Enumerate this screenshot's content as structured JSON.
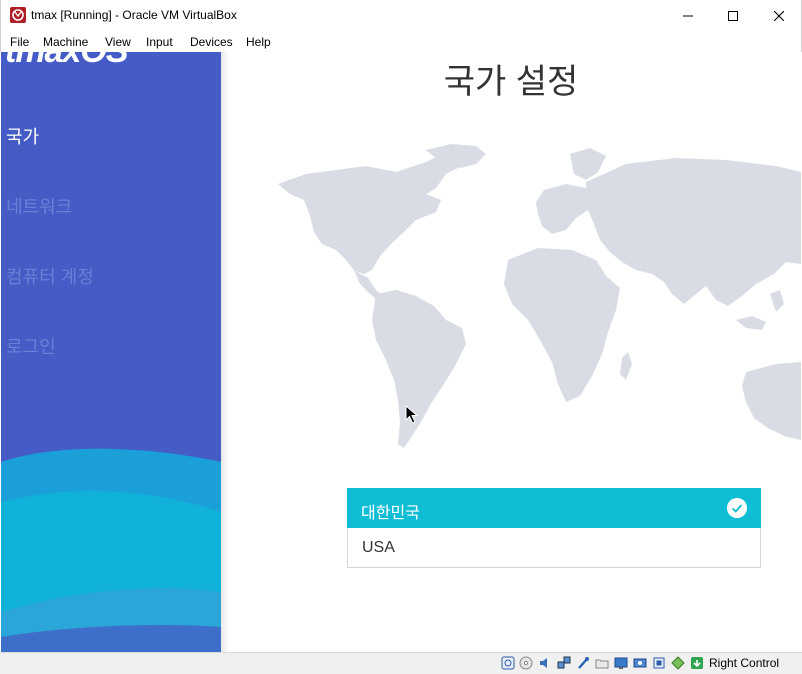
{
  "window": {
    "title": "tmax [Running] - Oracle VM VirtualBox",
    "app_icon": "virtualbox-icon",
    "controls": [
      "minimize-icon",
      "maximize-icon",
      "close-icon"
    ]
  },
  "menubar": {
    "items": [
      "File",
      "Machine",
      "View",
      "Input",
      "Devices",
      "Help"
    ]
  },
  "installer": {
    "logo_text": "tmaxOS",
    "steps": [
      {
        "label": "국가",
        "active": true
      },
      {
        "label": "네트워크",
        "active": false
      },
      {
        "label": "컴퓨터 계정",
        "active": false
      },
      {
        "label": "로그인",
        "active": false
      }
    ],
    "title": "국가 설정",
    "countries": [
      {
        "label": "대한민국",
        "selected": true
      },
      {
        "label": "USA",
        "selected": false
      }
    ],
    "colors": {
      "sidebar": "#455bc6",
      "accent": "#0fbdd4",
      "map": "#d9dbe5"
    }
  },
  "statusbar": {
    "icons": [
      "hard-disk-icon",
      "optical-drive-icon",
      "audio-icon",
      "network-icon",
      "usb-icon",
      "shared-folder-icon",
      "display-icon",
      "video-capture-icon",
      "cpu-icon",
      "mouse-integration-icon",
      "host-key-arrow-icon"
    ],
    "host_key": "Right Control"
  }
}
